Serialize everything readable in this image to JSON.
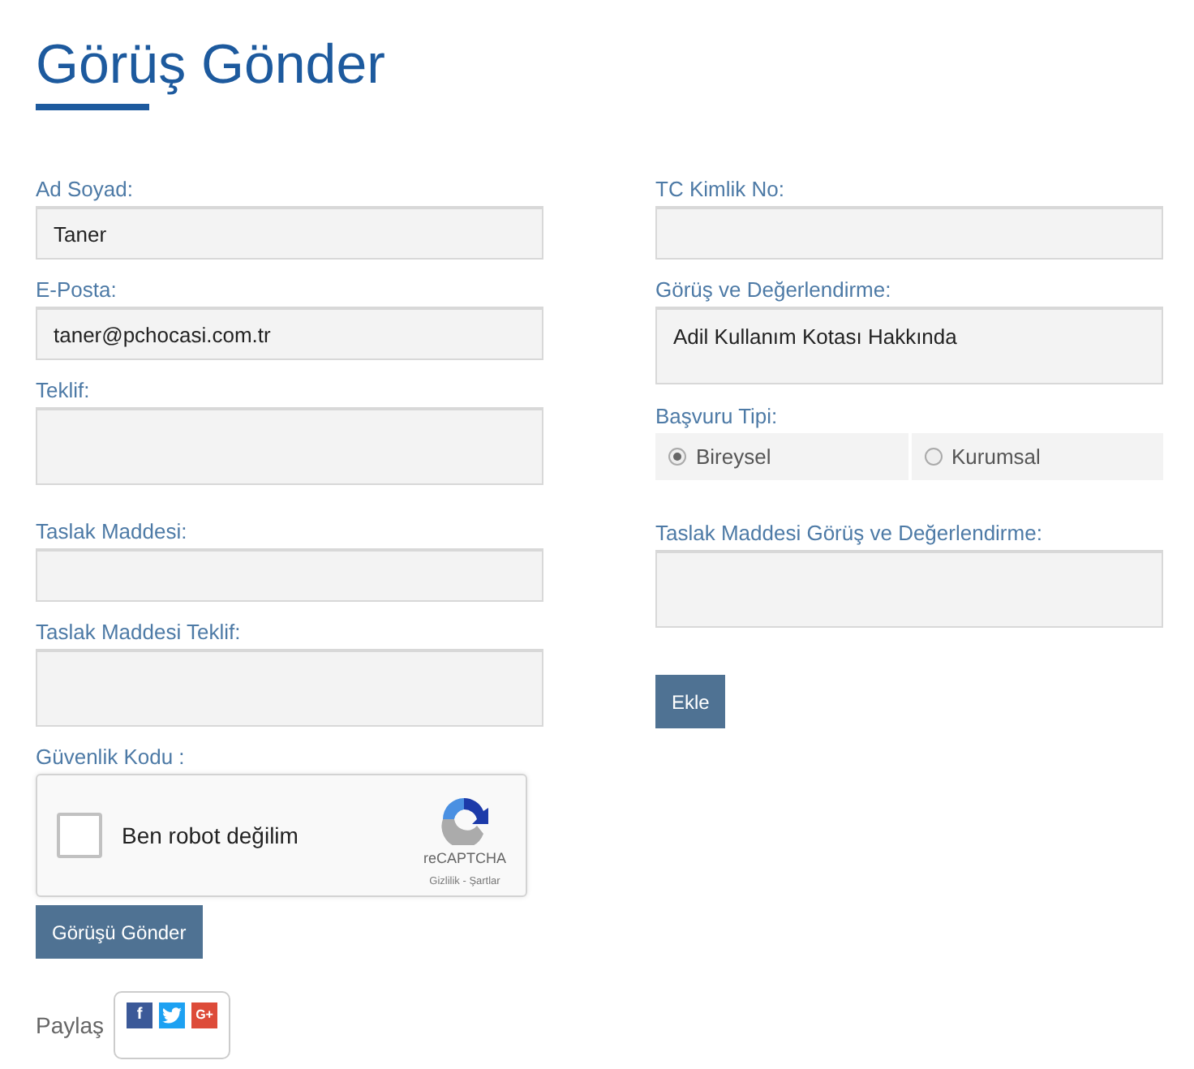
{
  "title": "Görüş Gönder",
  "left_fields": [
    {
      "kind": "input",
      "label": "Ad Soyad:",
      "value": "Taner"
    },
    {
      "kind": "input",
      "label": "E-Posta:",
      "value": "taner@pchocasi.com.tr"
    },
    {
      "kind": "textarea",
      "label": "Teklif:"
    },
    {
      "kind": "input",
      "label": "Taslak Maddesi:"
    },
    {
      "kind": "textarea",
      "label": "Taslak Maddesi Teklif:"
    }
  ],
  "captcha": {
    "label": "Güvenlik Kodu :",
    "checked": false,
    "text": "Ben robot değilim",
    "brand": "reCAPTCHA",
    "links": "Gizlilik - Şartlar"
  },
  "submit_button": "Görüşü Gönder",
  "share": {
    "label": "Paylaş",
    "buttons": [
      {
        "kind": "facebook",
        "text": "f"
      },
      {
        "kind": "twitter"
      },
      {
        "kind": "google",
        "text": "G+"
      }
    ]
  },
  "right_fields": [
    {
      "kind": "input",
      "label": "TC Kimlik No:"
    },
    {
      "kind": "textarea",
      "label": "Görüş ve Değerlendirme:",
      "value": "Adil Kullanım Kotası Hakkında"
    },
    {
      "kind": "radio",
      "label": "Başvuru Tipi:",
      "options": [
        {
          "label": "Bireysel",
          "selected": true
        },
        {
          "label": "Kurumsal",
          "selected": false
        }
      ]
    },
    {
      "kind": "textarea",
      "label": "Taslak Maddesi Görüş ve Değerlendirme:"
    }
  ],
  "add_button": "Ekle"
}
